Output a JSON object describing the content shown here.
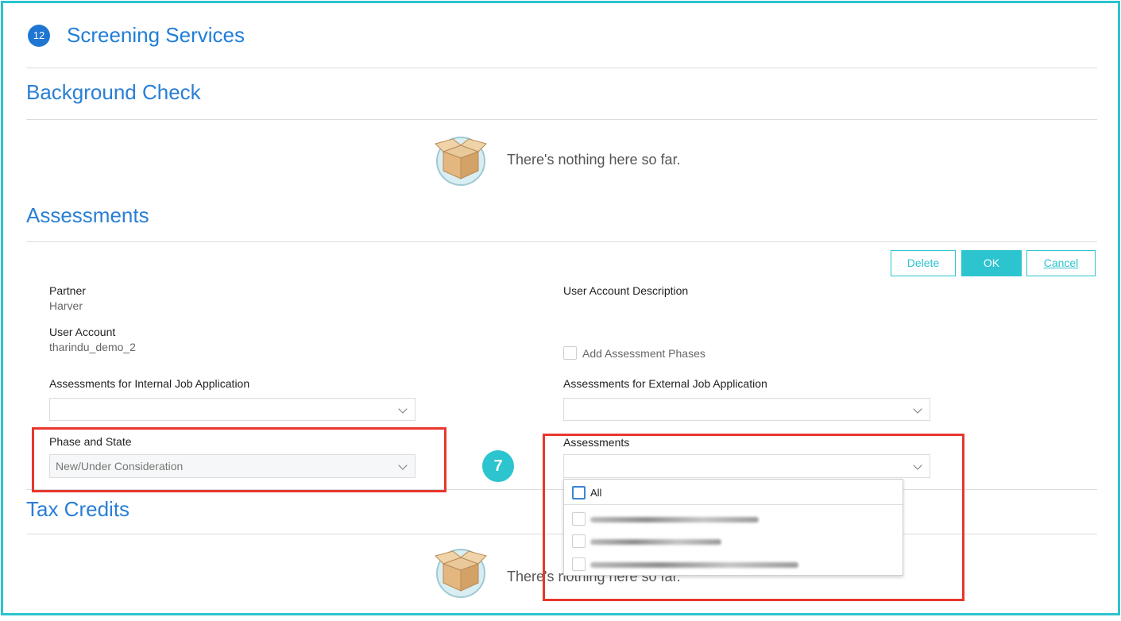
{
  "header": {
    "step_number": "12",
    "title": "Screening Services"
  },
  "background_check": {
    "title": "Background Check",
    "empty_text": "There's nothing here so far."
  },
  "assessments": {
    "title": "Assessments",
    "buttons": {
      "delete": "Delete",
      "ok": "OK",
      "cancel": "Cancel"
    },
    "partner_label": "Partner",
    "partner_value": "Harver",
    "user_account_label": "User Account",
    "user_account_value": "tharindu_demo_2",
    "user_account_description_label": "User Account Description",
    "add_phases_label": "Add Assessment Phases",
    "internal_label": "Assessments for Internal Job Application",
    "external_label": "Assessments for External Job Application",
    "phase_state_label": "Phase and State",
    "phase_state_value": "New/Under Consideration",
    "assessments_label": "Assessments",
    "dropdown_all": "All"
  },
  "tax_credits": {
    "title": "Tax Credits",
    "empty_text": "There's nothing here so far."
  },
  "annotation_number": "7",
  "colors": {
    "accent": "#2bc4cf",
    "title_blue": "#1f7ed8",
    "highlight_red": "#e8372d"
  }
}
